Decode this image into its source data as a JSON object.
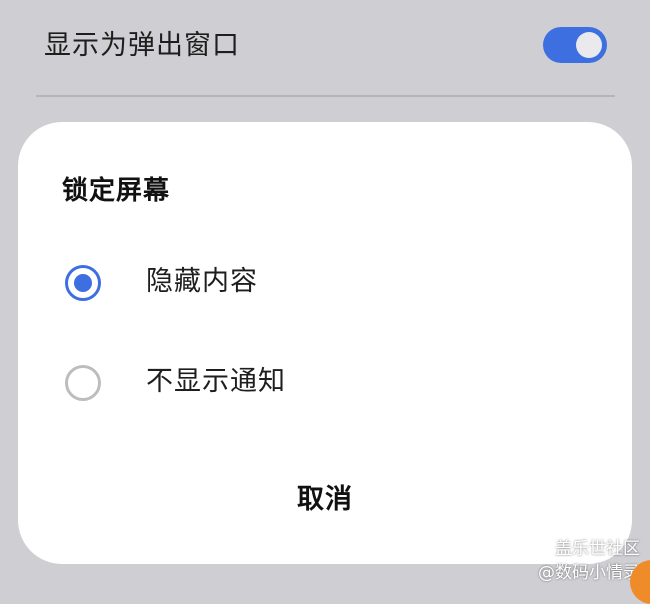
{
  "settings": {
    "popup_label": "显示为弹出窗口",
    "popup_enabled": true
  },
  "dialog": {
    "title": "锁定屏幕",
    "options": [
      {
        "label": "隐藏内容",
        "selected": true
      },
      {
        "label": "不显示通知",
        "selected": false
      }
    ],
    "cancel_label": "取消"
  },
  "watermark": {
    "line1": "盖乐世社区",
    "line2": "@数码小情录"
  },
  "colors": {
    "accent": "#3d6fe0",
    "background": "#cfcfd3",
    "dialog": "#ffffff"
  }
}
